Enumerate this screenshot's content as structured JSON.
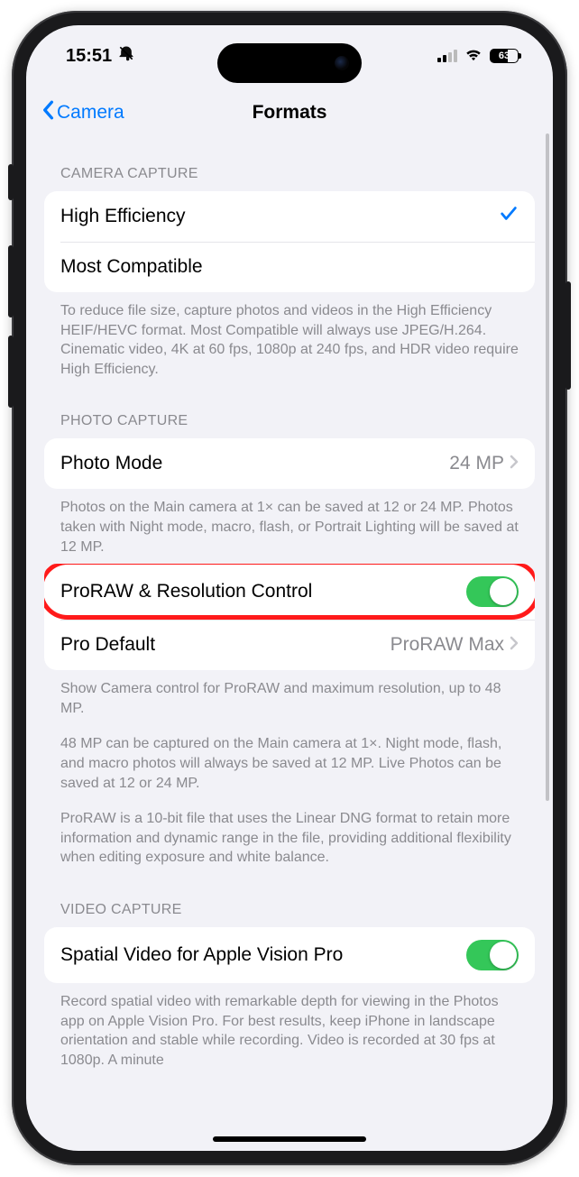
{
  "status": {
    "time": "15:51",
    "battery": "63"
  },
  "nav": {
    "back": "Camera",
    "title": "Formats"
  },
  "sections": {
    "cameraCapture": {
      "header": "CAMERA CAPTURE",
      "option1": "High Efficiency",
      "option2": "Most Compatible",
      "footer": "To reduce file size, capture photos and videos in the High Efficiency HEIF/HEVC format. Most Compatible will always use JPEG/H.264. Cinematic video, 4K at 60 fps, 1080p at 240 fps, and HDR video require High Efficiency."
    },
    "photoCapture": {
      "header": "PHOTO CAPTURE",
      "photoMode": {
        "label": "Photo Mode",
        "value": "24 MP"
      },
      "footer1": "Photos on the Main camera at 1× can be saved at 12 or 24 MP. Photos taken with Night mode, macro, flash, or Portrait Lighting will be saved at 12 MP.",
      "proraw": {
        "label": "ProRAW & Resolution Control",
        "on": true
      },
      "proDefault": {
        "label": "Pro Default",
        "value": "ProRAW Max"
      },
      "footer2a": "Show Camera control for ProRAW and maximum resolution, up to 48 MP.",
      "footer2b": "48 MP can be captured on the Main camera at 1×. Night mode, flash, and macro photos will always be saved at 12 MP. Live Photos can be saved at 12 or 24 MP.",
      "footer2c": "ProRAW is a 10-bit file that uses the Linear DNG format to retain more information and dynamic range in the file, providing additional flexibility when editing exposure and white balance."
    },
    "videoCapture": {
      "header": "VIDEO CAPTURE",
      "spatial": {
        "label": "Spatial Video for Apple Vision Pro",
        "on": true
      },
      "footer": "Record spatial video with remarkable depth for viewing in the Photos app on Apple Vision Pro. For best results, keep iPhone in landscape orientation and stable while recording. Video is recorded at 30 fps at 1080p. A minute"
    }
  }
}
